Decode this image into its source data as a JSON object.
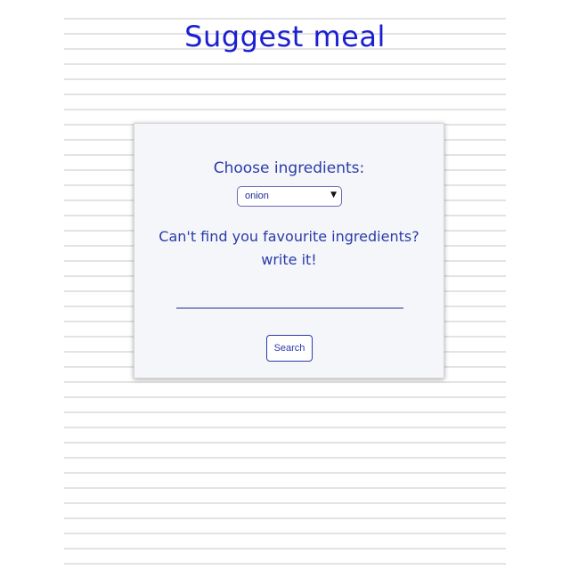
{
  "header": {
    "title": "Suggest meal"
  },
  "form": {
    "choose_label": "Choose ingredients:",
    "ingredient_select": {
      "selected_value": "onion",
      "arrow_icon": "triangle-down-icon"
    },
    "write_label_line1": "Can't find you favourite ingredients?",
    "write_label_line2": "write it!",
    "ingredient_input": {
      "value": "",
      "placeholder": ""
    },
    "search_label": "Search"
  },
  "colors": {
    "title": "#1a1fd0",
    "label": "#2a3ba8",
    "card_background": "#f5f6fa",
    "button_border": "#2a3bb0"
  }
}
